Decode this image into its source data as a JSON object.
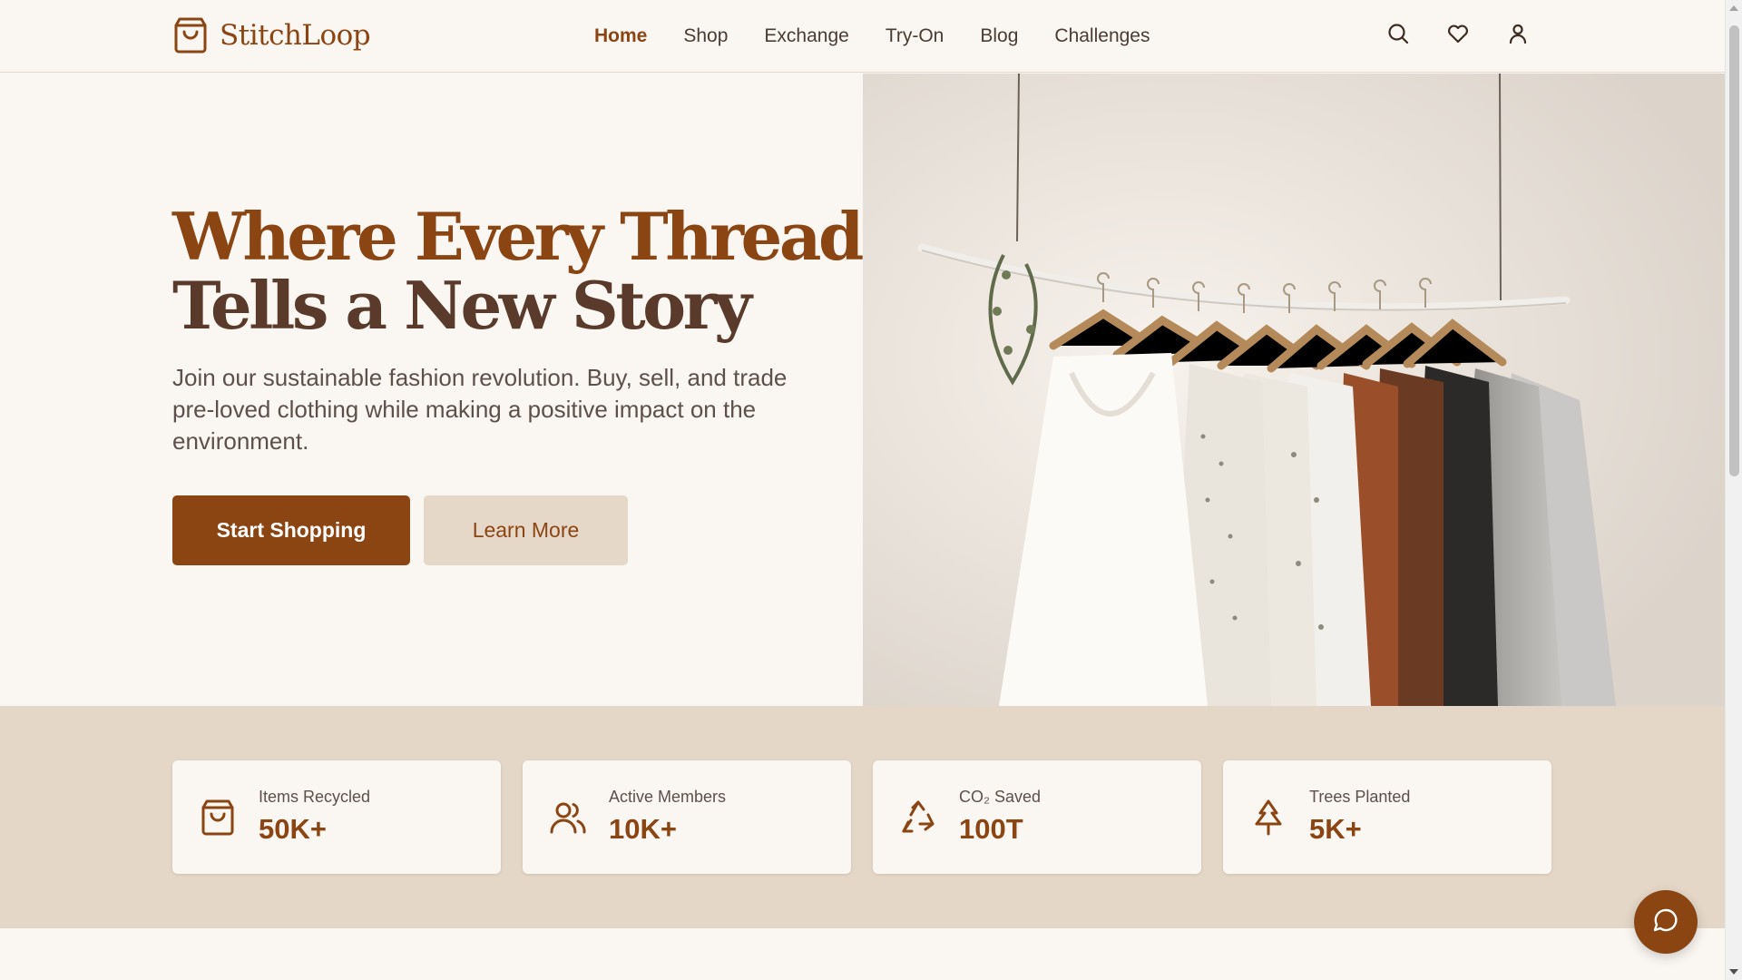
{
  "brand": {
    "name": "StitchLoop",
    "logo_icon": "shopping-bag-icon"
  },
  "nav": {
    "items": [
      {
        "label": "Home",
        "active": true
      },
      {
        "label": "Shop",
        "active": false
      },
      {
        "label": "Exchange",
        "active": false
      },
      {
        "label": "Try-On",
        "active": false
      },
      {
        "label": "Blog",
        "active": false
      },
      {
        "label": "Challenges",
        "active": false
      }
    ]
  },
  "header_icons": [
    "search-icon",
    "heart-icon",
    "user-icon"
  ],
  "hero": {
    "title_line1": "Where Every Thread",
    "title_line2": "Tells a New Story",
    "subtitle": "Join our sustainable fashion revolution. Buy, sell, and trade pre-loved clothing while making a positive impact on the environment.",
    "primary_button": "Start Shopping",
    "secondary_button": "Learn More",
    "image_subject": "clothes-rack-photo"
  },
  "stats": [
    {
      "label": "Items Recycled",
      "value": "50K+",
      "icon": "shopping-bag-icon"
    },
    {
      "label": "Active Members",
      "value": "10K+",
      "icon": "users-icon"
    },
    {
      "label": "CO₂ Saved",
      "value": "100T",
      "icon": "recycle-icon"
    },
    {
      "label": "Trees Planted",
      "value": "5K+",
      "icon": "tree-icon"
    }
  ],
  "chat": {
    "icon": "chat-bubble-icon"
  },
  "colors": {
    "accent": "#8b4513",
    "title_dark": "#5a3a2a",
    "background": "#faf6f2",
    "stats_band": "#e4d7c7",
    "secondary_button": "#e6d8c9"
  }
}
